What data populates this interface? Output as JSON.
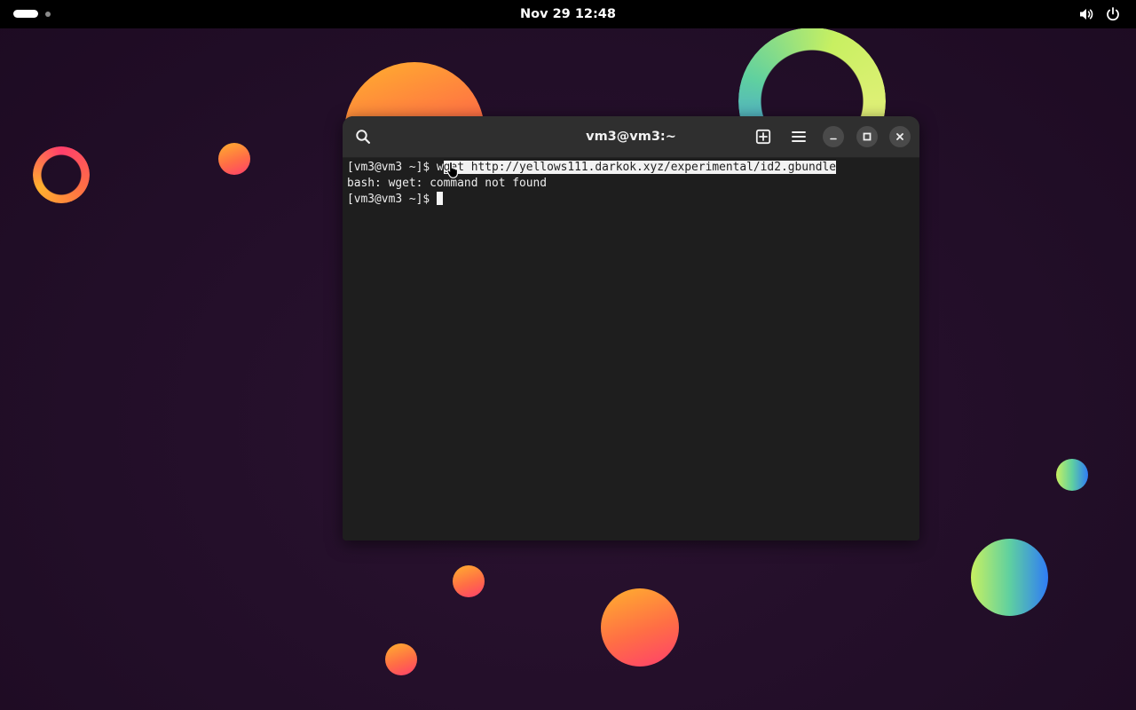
{
  "topbar": {
    "clock": "Nov 29  12:48",
    "icons": [
      "volume-icon",
      "power-icon"
    ]
  },
  "window": {
    "title": "vm3@vm3:~",
    "header_icons": [
      "search-icon",
      "new-tab-icon",
      "hamburger-menu-icon",
      "minimize-icon",
      "maximize-icon",
      "close-icon"
    ]
  },
  "terminal": {
    "line1_prompt": "[vm3@vm3 ~]$ ",
    "line1_cmd_start": "w",
    "line1_cmd_selected": "get http://yellows111.darkok.xyz/experimental/id2.gbundle",
    "line2": "bash: wget: command not found",
    "line3_prompt": "[vm3@vm3 ~]$ "
  },
  "colors": {
    "topbar_bg": "#000000",
    "header_bg": "#2f2f2f",
    "terminal_bg": "#1e1e1e",
    "terminal_fg": "#ededed",
    "selection_bg": "#f2f2f2",
    "wallpaper_bg": "#24102a"
  }
}
